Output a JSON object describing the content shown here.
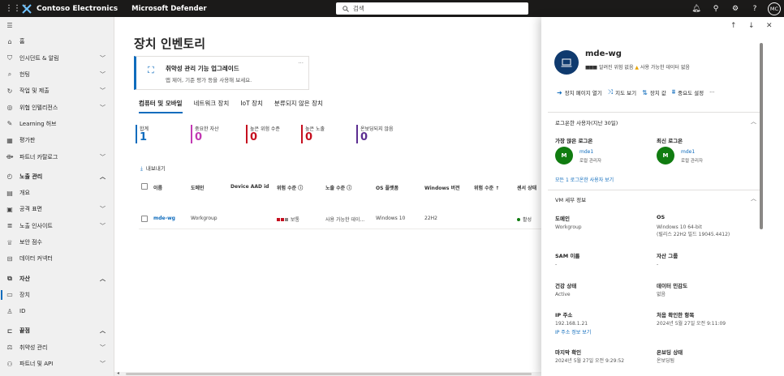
{
  "topbar": {
    "brand": "Contoso Electronics",
    "product": "Microsoft Defender",
    "search_placeholder": "검색",
    "avatar": "MC"
  },
  "sidebar": {
    "items": [
      {
        "label": "홈",
        "icon": "home-icon",
        "chevron": false,
        "section": false
      },
      {
        "label": "인시던트 & 알림",
        "icon": "shield-icon",
        "chevron": true,
        "section": false
      },
      {
        "label": "헌팅",
        "icon": "hunting-icon",
        "chevron": true,
        "section": false
      },
      {
        "label": "작업 및 제출",
        "icon": "actions-icon",
        "chevron": true,
        "section": false
      },
      {
        "label": "위협 인텔리전스",
        "icon": "intel-icon",
        "chevron": true,
        "section": false
      },
      {
        "label": "Learning 허브",
        "icon": "learning-icon",
        "chevron": false,
        "section": false
      },
      {
        "label": "평가판",
        "icon": "trial-icon",
        "chevron": false,
        "section": false
      },
      {
        "label": "파트너 카탈로그",
        "icon": "partner-icon",
        "chevron": true,
        "section": false
      },
      {
        "label": "노출 관리",
        "icon": "exposure-icon",
        "chevron": true,
        "section": true,
        "gap": true
      },
      {
        "label": "개요",
        "icon": "overview-icon",
        "chevron": false,
        "section": false
      },
      {
        "label": "공격 표면",
        "icon": "attack-icon",
        "chevron": true,
        "section": false
      },
      {
        "label": "노출 인사이트",
        "icon": "insight-icon",
        "chevron": true,
        "section": false
      },
      {
        "label": "보안 점수",
        "icon": "score-icon",
        "chevron": false,
        "section": false
      },
      {
        "label": "데이터 커넥터",
        "icon": "connector-icon",
        "chevron": false,
        "section": false
      },
      {
        "label": "자산",
        "icon": "assets-icon",
        "chevron": true,
        "section": true,
        "gap": true
      },
      {
        "label": "장치",
        "icon": "device-icon",
        "chevron": false,
        "section": false,
        "active": true
      },
      {
        "label": "ID",
        "icon": "identity-icon",
        "chevron": false,
        "section": false
      },
      {
        "label": "끝점",
        "icon": "endpoint-icon",
        "chevron": true,
        "section": true,
        "gap": true
      },
      {
        "label": "취약성 관리",
        "icon": "vuln-icon",
        "chevron": true,
        "section": false
      },
      {
        "label": "파트너 및 API",
        "icon": "api-icon",
        "chevron": true,
        "section": false
      }
    ]
  },
  "main": {
    "title": "장치 인벤토리",
    "banner": {
      "title": "취약성 관리 기능 업그레이드",
      "subtitle": "앱 제어, 기준 평가 등을 사용해 보세요.",
      "more": "···"
    },
    "tabs": [
      "컴퓨터 및 모바일",
      "네트워크 장치",
      "IoT 장치",
      "분류되지 않은 장치"
    ],
    "stats": [
      {
        "label": "합계",
        "value": "1",
        "color": "#0f6cbd"
      },
      {
        "label": "중요한 자산",
        "value": "0",
        "color": "#c239b3"
      },
      {
        "label": "높은 위험 수준",
        "value": "0",
        "color": "#c50f1f"
      },
      {
        "label": "높은 노출",
        "value": "0",
        "color": "#c50f1f"
      },
      {
        "label": "온보딩되지 않음",
        "value": "0",
        "color": "#5c2e91"
      }
    ],
    "export_label": "내보내기",
    "columns": [
      "이름",
      "도메인",
      "Device AAD id",
      "위험 수준 ⓘ",
      "노출 수준 ⓘ",
      "OS 플랫폼",
      "Windows 버전",
      "위험 수준 ↑",
      "센서 상태"
    ],
    "row": {
      "name": "mde-wg",
      "domain": "Workgroup",
      "aad": "",
      "risk": "보통",
      "exposure": "사용 가능한 데이...",
      "os": "Windows 10",
      "version": "22H2",
      "sensor": "활성"
    }
  },
  "panel": {
    "device_name": "mde-wg",
    "subtitle_risk": "알려진 위험 없음",
    "subtitle_exposure": "사용 가능한 데이터 없음",
    "actions": [
      "장치 페이지 열기",
      "지도 보기",
      "장치 값",
      "중요도 설정",
      "···"
    ],
    "logon_section": "로그온한 사용자",
    "logon_period": "(지난 30일)",
    "most_logons_label": "가장 많은 로그온",
    "recent_logon_label": "최신 로그온",
    "user1": {
      "name": "mde1",
      "role": "로컬 관리자",
      "initial": "M"
    },
    "user2": {
      "name": "mde1",
      "role": "로컬 관리자",
      "initial": "M"
    },
    "view_all_link": "모든 1 로그온한 사용자 보기",
    "vm_section": "VM 세부 정보",
    "fields": {
      "domain_label": "도메인",
      "domain_value": "Workgroup",
      "os_label": "OS",
      "os_value": "Windows 10 64-bit",
      "os_value2": "(릴리스 22H2 빌드 19045.4412)",
      "sam_label": "SAM 이름",
      "sam_value": "-",
      "asset_group_label": "자산 그룹",
      "asset_group_value": "-",
      "health_label": "건강 상태",
      "health_value": "Active",
      "sensitivity_label": "데이터 민감도",
      "sensitivity_value": "없음",
      "ip_label": "IP 주소",
      "ip_value": "192.168.1.21",
      "ip_link": "IP 주소 정보 보기",
      "first_seen_label": "처음 확인한 항목",
      "first_seen_value": "2024년 5월 27일 오전 9:11:09",
      "last_seen_label": "마지막 확인",
      "last_seen_value": "2024년 5월 27일 오전 9:29:52",
      "onboarding_label": "온보딩 상태",
      "onboarding_value": "온보딩됨"
    }
  }
}
